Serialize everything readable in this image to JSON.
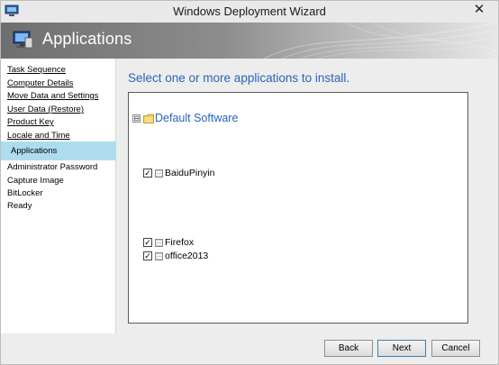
{
  "window": {
    "title": "Windows Deployment Wizard",
    "close_glyph": "✕"
  },
  "banner": {
    "title": "Applications",
    "icon": "computer-icon"
  },
  "nav": {
    "items": [
      {
        "label": "Task Sequence",
        "state": "link"
      },
      {
        "label": "Computer Details",
        "state": "link"
      },
      {
        "label": "Move Data and Settings",
        "state": "link"
      },
      {
        "label": "User Data (Restore)",
        "state": "link"
      },
      {
        "label": "Product Key",
        "state": "link"
      },
      {
        "label": "Locale and Time",
        "state": "link"
      },
      {
        "label": "Applications",
        "state": "active"
      },
      {
        "label": "Administrator Password",
        "state": "plain"
      },
      {
        "label": "Capture Image",
        "state": "plain"
      },
      {
        "label": "BitLocker",
        "state": "plain"
      },
      {
        "label": "Ready",
        "state": "plain"
      }
    ],
    "active_color": "#aedcef"
  },
  "main": {
    "prompt": "Select one or more applications to install.",
    "tree": {
      "group": {
        "label": "Default Software",
        "expander": "⊟"
      },
      "apps": [
        {
          "label": "BaiduPinyin",
          "checked": true
        },
        {
          "label": "Firefox",
          "checked": true
        },
        {
          "label": "office2013",
          "checked": true
        }
      ]
    }
  },
  "footer": {
    "back_label": "Back",
    "next_label": "Next",
    "cancel_label": "Cancel"
  },
  "colors": {
    "accent_text": "#2a64b8",
    "banner_dark": "#6f6f6f"
  }
}
